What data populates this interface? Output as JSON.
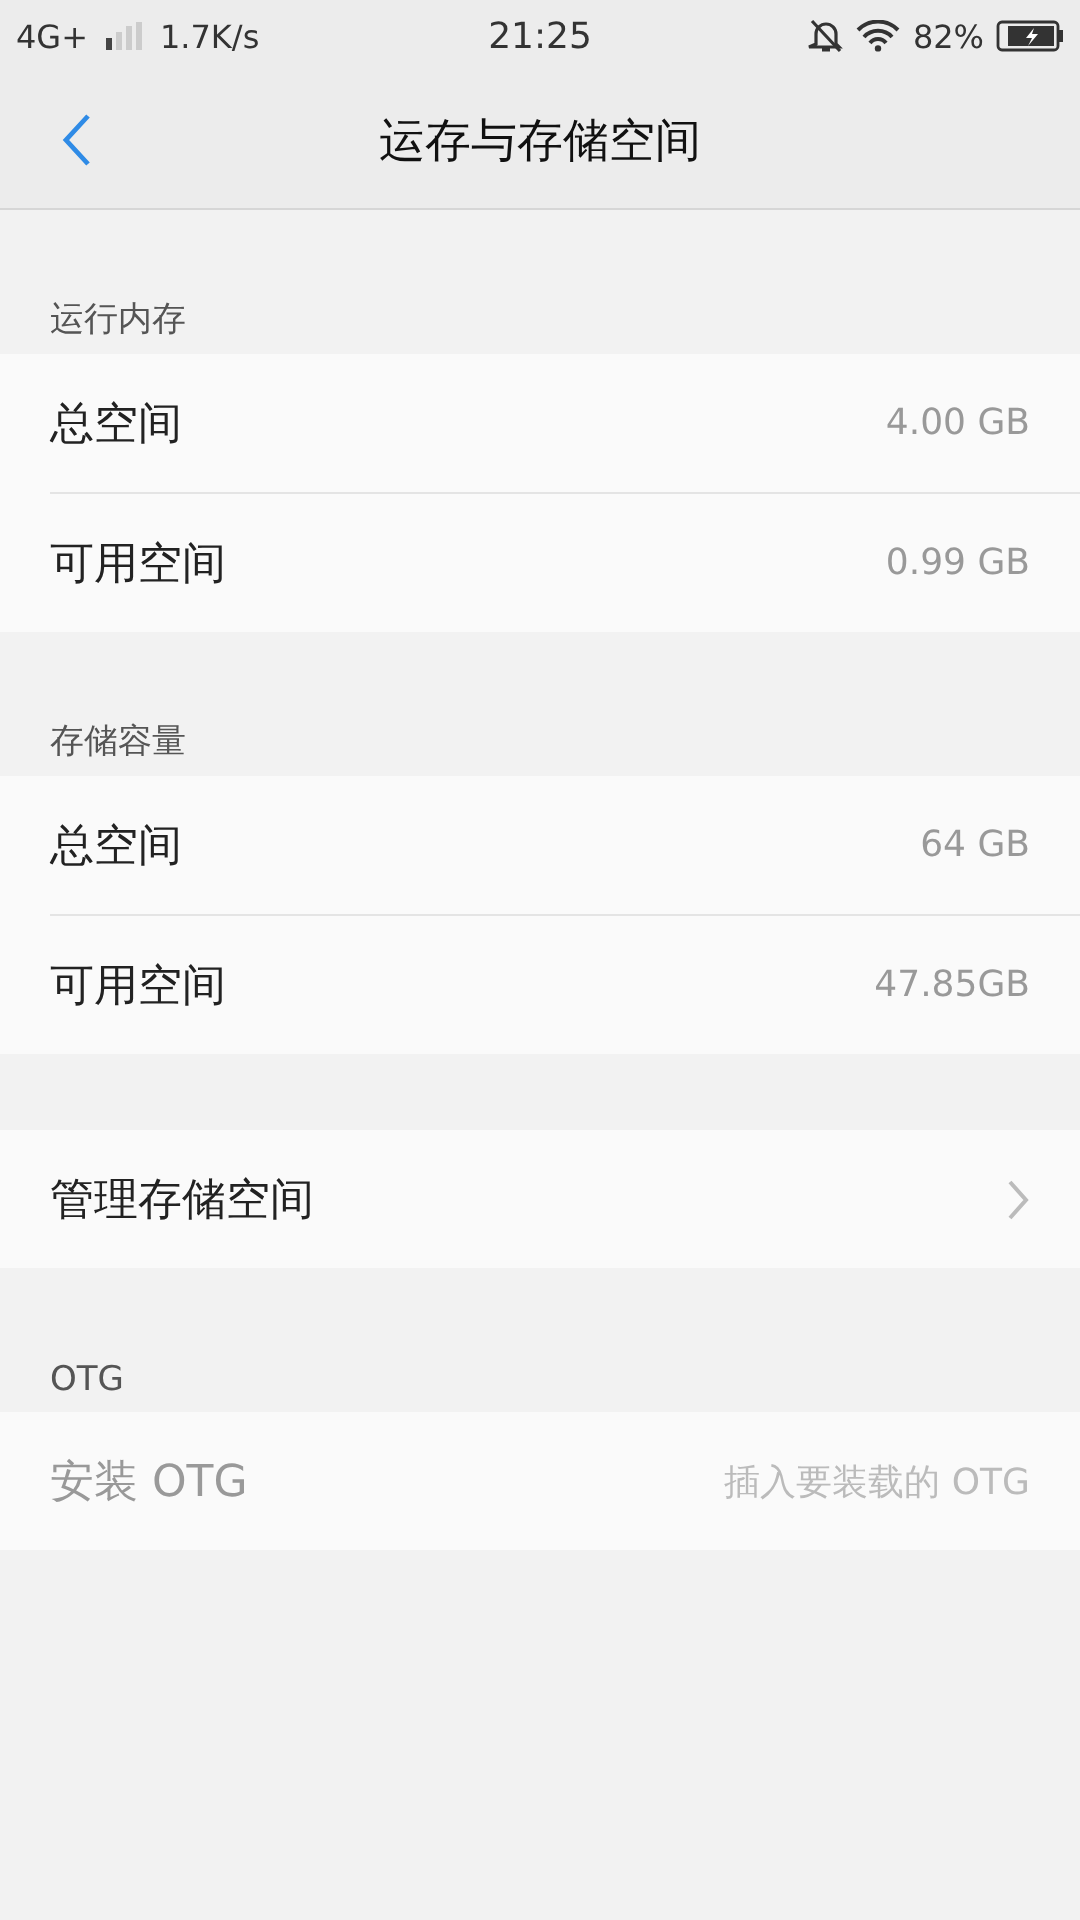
{
  "status_bar": {
    "network": "4G+",
    "speed": "1.7K/s",
    "time": "21:25",
    "battery": "82%"
  },
  "header": {
    "title": "运存与存储空间"
  },
  "sections": [
    {
      "title": "运行内存",
      "rows": [
        {
          "kind": "value",
          "label": "总空间",
          "value": "4.00 GB",
          "disabled": false
        },
        {
          "kind": "value",
          "label": "可用空间",
          "value": "0.99 GB",
          "disabled": false
        }
      ]
    },
    {
      "title": "存储容量",
      "rows": [
        {
          "kind": "value",
          "label": "总空间",
          "value": "64 GB",
          "disabled": false
        },
        {
          "kind": "value",
          "label": "可用空间",
          "value": "47.85GB",
          "disabled": false
        }
      ]
    },
    {
      "rows": [
        {
          "kind": "link",
          "label": "管理存储空间",
          "disabled": false
        }
      ]
    },
    {
      "title": "OTG",
      "rows": [
        {
          "kind": "value",
          "label": "安装 OTG",
          "value": "插入要装载的 OTG",
          "disabled": true
        }
      ]
    }
  ]
}
